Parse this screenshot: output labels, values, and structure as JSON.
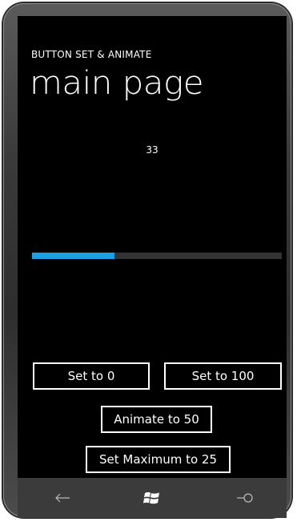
{
  "app": {
    "title": "BUTTON SET & ANIMATE",
    "page_title": "main page"
  },
  "progress": {
    "value_text": "33",
    "value": 33,
    "maximum": 100,
    "accent_color": "#1ba1e2",
    "track_color": "#333333"
  },
  "buttons": {
    "set_zero": "Set to 0",
    "set_hundred": "Set to 100",
    "animate": "Animate to 50",
    "set_max": "Set Maximum to 25"
  },
  "hardware_keys": {
    "back_icon": "back-arrow-icon",
    "start_icon": "windows-logo-icon",
    "search_icon": "search-icon"
  }
}
